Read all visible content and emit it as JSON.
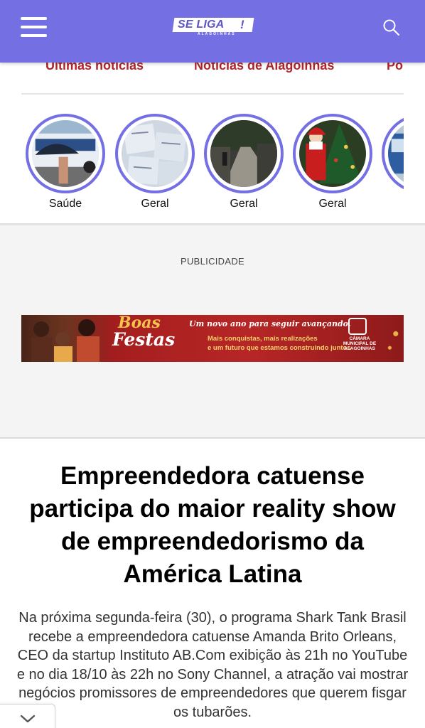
{
  "header": {
    "background": "#7470e3",
    "logo_text": "SE LIGA",
    "logo_mark": "!",
    "logo_sub": "ALAGOINHAS",
    "menu_icon": "hamburger-icon",
    "search_icon": "search-icon"
  },
  "tabs": [
    {
      "label": "Últimas notícias"
    },
    {
      "label": "Notícias de Alagoinhas"
    },
    {
      "label": "Po"
    }
  ],
  "stories": [
    {
      "label": "Saúde",
      "image": "bus-umbrella-photo"
    },
    {
      "label": "Geral",
      "image": "documents-photo"
    },
    {
      "label": "Geral",
      "image": "street-photo"
    },
    {
      "label": "Geral",
      "image": "santa-christmas-photo"
    },
    {
      "label": ".",
      "image": "bus-photo"
    }
  ],
  "ad": {
    "label": "PUBLICIDADE",
    "boas": "Boas",
    "festas": "Festas",
    "line1": "Um novo ano para seguir avançando.",
    "line2": "Mais conquistas, mais realizações",
    "line3": "e um futuro que estamos construindo juntos",
    "org": "CÂMARA MUNICIPAL DE ALAGOINHAS"
  },
  "article": {
    "title": "Empreendedora catuense participa do maior reality show de empreendedorismo da América Latina",
    "body": "Na próxima segunda-feira (30), o programa Shark Tank Brasil recebe a empreendedora catuense Amanda Brito Orleans, CEO da startup Instituto AB.Com exibição às 21h no YouTube e no dia 18/10 às 22h no Sony Channel, a atração vai mostrar negócios promissores de empreendedores que querem fisgar os tubarões."
  },
  "colors": {
    "accent": "#7470e3",
    "tab_red": "#b0252c"
  }
}
